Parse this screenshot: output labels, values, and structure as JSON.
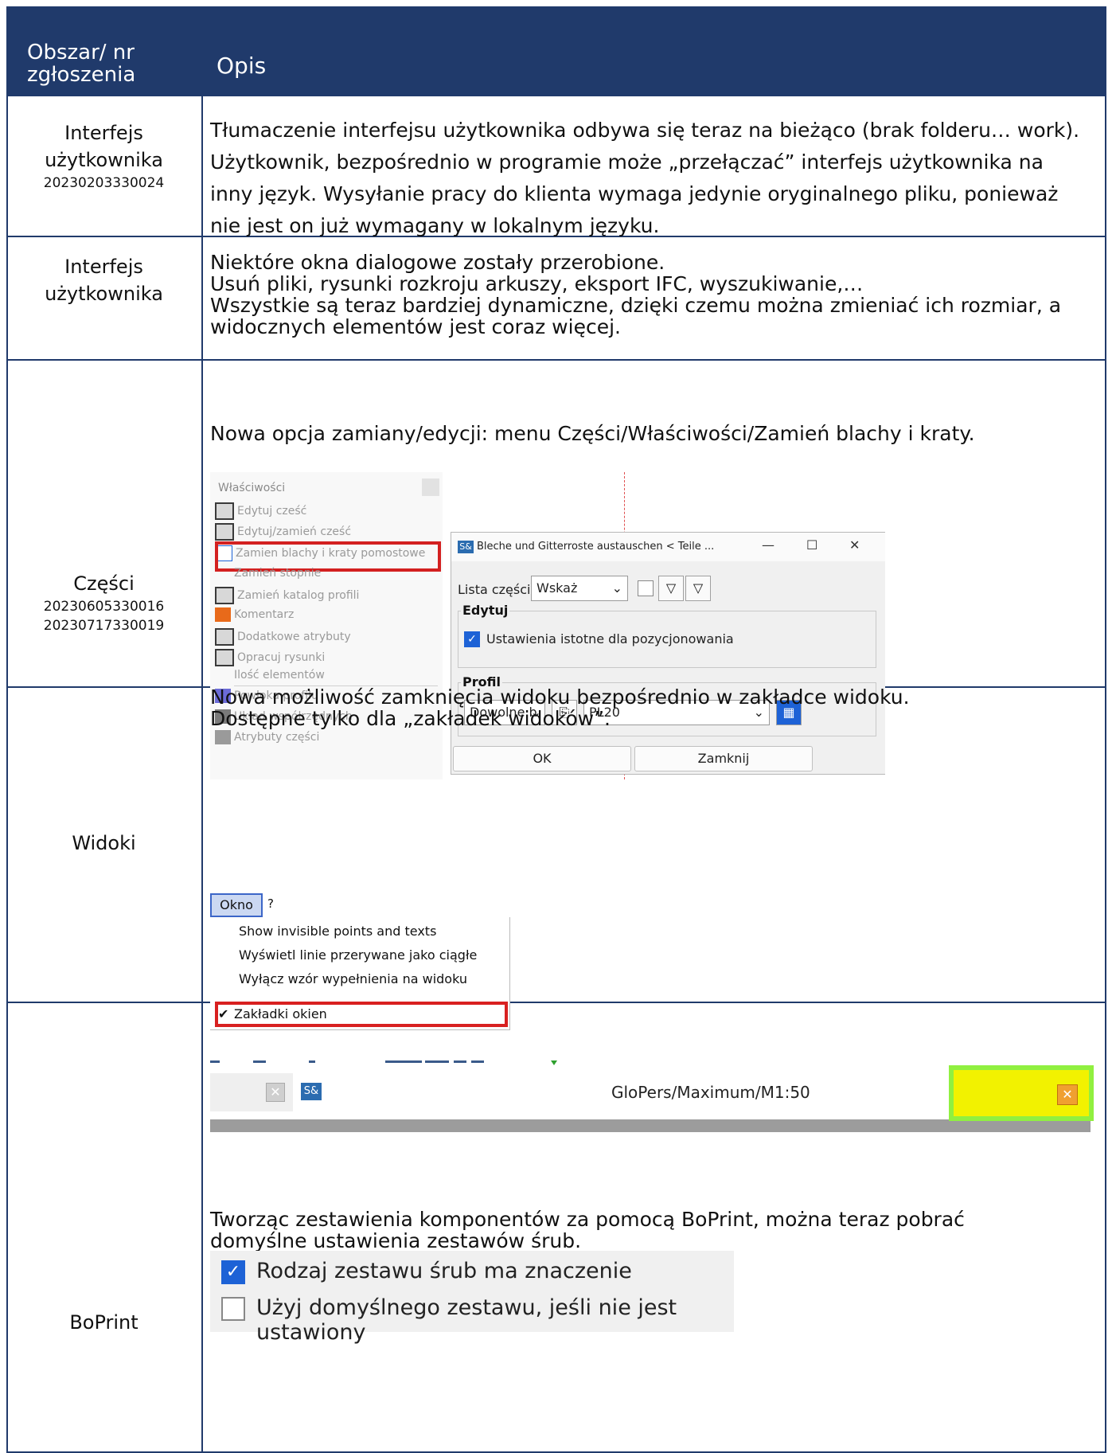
{
  "header": {
    "col1": "Obszar/ nr\nzgłoszenia",
    "col1_l1": "Obszar/ nr",
    "col1_l2": "zgłoszenia",
    "col2": "Opis"
  },
  "rows": [
    {
      "area": "Interfejs użytkownika",
      "area_l1": "Interfejs",
      "area_l2": "użytkownika",
      "num": "20230203330024",
      "text": "Tłumaczenie interfejsu użytkownika odbywa się teraz na bieżąco (brak folderu… work). Użytkownik, bezpośrednio w programie może „przełączać” interfejs użytkownika na inny język. Wysyłanie pracy do klienta wymaga jedynie oryginalnego pliku, ponieważ nie jest on już wymagany w lokalnym języku."
    },
    {
      "area_l1": "Interfejs",
      "area_l2": "użytkownika",
      "line1": "Niektóre okna dialogowe zostały przerobione.",
      "line2": "Usuń pliki, rysunki rozkroju arkuszy, eksport IFC, wyszukiwanie,…",
      "line3": "Wszystkie są teraz bardziej dynamiczne, dzięki czemu można zmieniać ich rozmiar, a widocznych elementów jest coraz więcej."
    },
    {
      "area": "Części",
      "num1": "20230605330016",
      "num2": "20230717330019",
      "text": "Nowa opcja zamiany/edycji: menu Części/Właściwości/Zamień blachy i kraty."
    },
    {
      "area": "Widoki",
      "line1": "Nowa możliwość zamknięcia widoku bezpośrednio w zakładce widoku.",
      "line2": "Dostępne tylko dla „zakładek widoków”."
    },
    {
      "area": "BoPrint",
      "line1": "Tworząc zestawienia komponentów za pomocą BoPrint, można teraz pobrać",
      "line2": "domyślne ustawienia zestawów śrub."
    }
  ],
  "shot1": {
    "menu_title": "Właściwości",
    "menu_items": [
      "Edytuj cześć",
      "Edytuj/zamień cześć",
      "Zamien blachy i kraty pomostowe",
      "Zamień stopnie",
      "Zamień katalog profili",
      "Komentarz",
      "Dodatkowe atrybuty",
      "Opracuj rysunki",
      "Ilość elementów",
      "Powłoka profilu",
      "Układ współrzędnych",
      "Atrybuty części"
    ],
    "dialog_icon": "S&",
    "dialog_title": "Bleche und Gitterroste austauschen < Teile ...",
    "win_min": "—",
    "win_max": "☐",
    "win_close": "✕",
    "parts_list_label": "Lista części",
    "parts_list_value": "Wskaż",
    "edit_group": "Edytuj",
    "edit_checkbox": "Ustawienia istotne dla pozycjonowania",
    "profile_group": "Profil",
    "profile_type": "Dowolne b",
    "profile_value": "PL20",
    "ok": "OK",
    "close": "Zamknij"
  },
  "shot2": {
    "menu": "Okno",
    "help": "?",
    "items": [
      "Show invisible points and texts",
      "Wyświetl linie przerywane jako ciągłe",
      "Wyłącz wzór wypełnienia na widoku",
      "Zakładki okien"
    ],
    "checkmark": "✔",
    "tab_icon": "S&",
    "tab_title": "GloPers/Maximum/M1:50",
    "close_glyph": "✕"
  },
  "shot3": {
    "opt1": "Rodzaj zestawu śrub ma znaczenie",
    "opt2": "Użyj domyślnego zestawu, jeśli nie jest ustawiony"
  }
}
